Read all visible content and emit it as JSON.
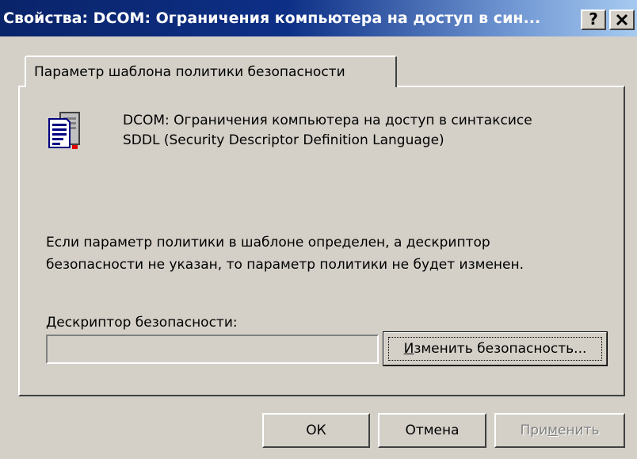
{
  "window": {
    "title": "Свойства: DCOM: Ограничения компьютера на доступ в син...",
    "help_button": "?",
    "close_button": "×"
  },
  "tabs": [
    {
      "label": "Параметр шаблона политики безопасности",
      "selected": true
    }
  ],
  "panel": {
    "icon": "policy-document-icon",
    "policy_name_line1": "DCOM: Ограничения компьютера на доступ в синтаксисе",
    "policy_name_line2": "SDDL (Security Descriptor Definition Language)",
    "info_line1": "Если параметр политики в шаблоне определен, а дескриптор",
    "info_line2": "безопасности не указан, то параметр политики не будет изменен.",
    "descriptor_label_mnemonic": "Д",
    "descriptor_label_rest": "ескриптор безопасности:",
    "descriptor_value": "",
    "change_button_mnemonic": "И",
    "change_button_rest": "зменить безопасность..."
  },
  "buttons": {
    "ok": "ОК",
    "cancel": "Отмена",
    "apply_prefix": "При",
    "apply_mnemonic": "м",
    "apply_suffix": "енить",
    "apply_disabled": true
  }
}
